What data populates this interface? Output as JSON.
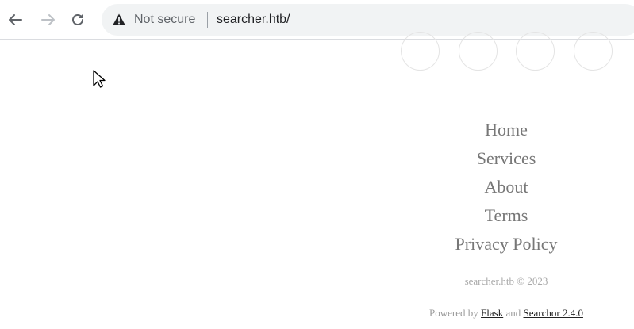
{
  "browser": {
    "security_label": "Not secure",
    "url": "searcher.htb/",
    "icons": {
      "back": "back-arrow-icon",
      "forward": "forward-arrow-icon",
      "reload": "reload-icon",
      "security": "warning-triangle-icon"
    }
  },
  "social": {
    "icons": [
      "social-circle-1",
      "social-circle-2",
      "social-circle-3",
      "social-circle-4"
    ]
  },
  "footer": {
    "menu": [
      "Home",
      "Services",
      "About",
      "Terms",
      "Privacy Policy"
    ],
    "copyright": "searcher.htb © 2023",
    "powered_prefix": "Powered by",
    "powered_link1": "Flask",
    "powered_and": "and",
    "powered_link2": "Searchor 2.4.0"
  },
  "colors": {
    "menu_text": "#777777",
    "muted_text": "#a9a9a9",
    "link_text": "#222222",
    "omnibox_bg": "#f1f3f4"
  }
}
